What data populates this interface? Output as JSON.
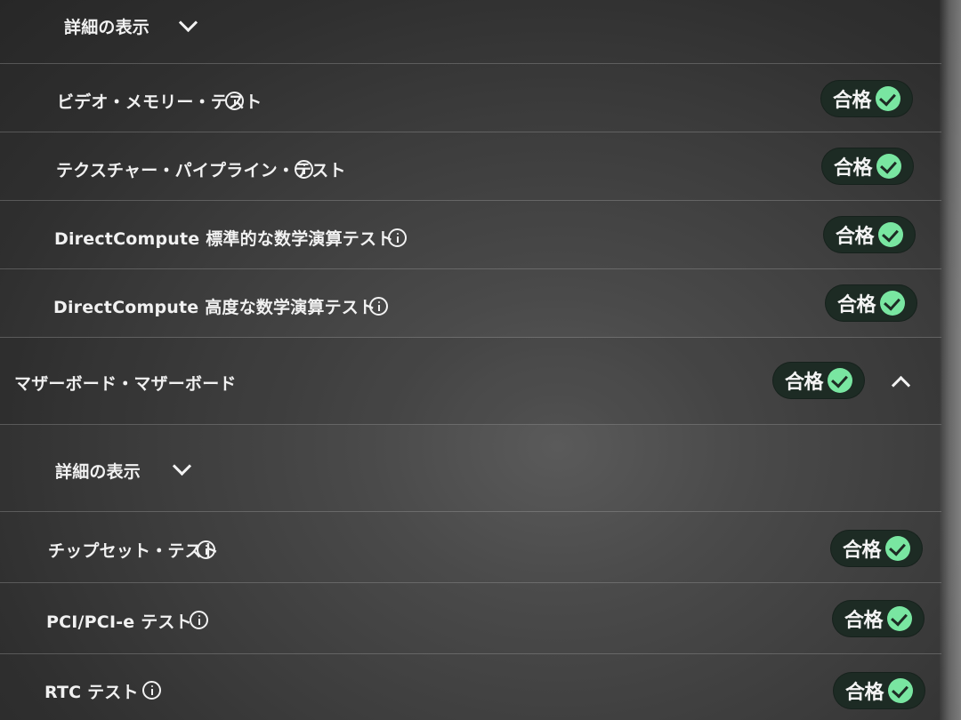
{
  "details_toggle_label": "詳細の表示",
  "pass_label": "合格",
  "gpu_tests": [
    {
      "label": "ビデオ・メモリー・テスト"
    },
    {
      "label": "テクスチャー・パイプライン・テスト"
    },
    {
      "label": "DirectCompute 標準的な数学演算テスト"
    },
    {
      "label": "DirectCompute 高度な数学演算テスト"
    }
  ],
  "motherboard_section": {
    "title": "マザーボード・マザーボード"
  },
  "motherboard_tests": [
    {
      "label": "チップセット・テスト"
    },
    {
      "label": "PCI/PCI-e テスト"
    },
    {
      "label": "RTC テスト"
    }
  ],
  "colors": {
    "background": "#3a3a3a",
    "badge_background": "#1d2b24",
    "pass_check": "#79e6a1",
    "text": "#f1f1f1"
  },
  "icons": {
    "info": "info-icon",
    "check": "check-icon",
    "expand": "chevron-down-icon",
    "collapse": "chevron-up-icon"
  }
}
